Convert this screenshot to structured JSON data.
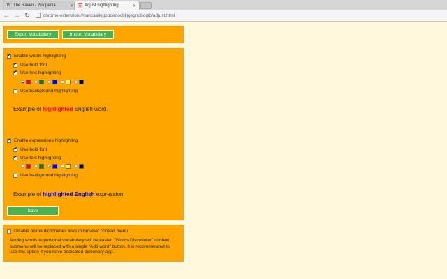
{
  "browser": {
    "tabs": [
      {
        "label": "The Raven - Wikipedia",
        "favicon": "W"
      },
      {
        "label": "Adjust highlighting",
        "favicon": "adjust"
      }
    ],
    "url": "chrome-extension://nancaalkjgpbdeoocblljgegnobogib/adjust.html"
  },
  "vocab": {
    "export_label": "Export Vocabulary",
    "import_label": "Import Vocabulary"
  },
  "words": {
    "enable_label": "Enable words highlighting",
    "bold_label": "Use bold font",
    "text_label": "Use text highlighting",
    "bg_label": "Use background highlighting",
    "colors": [
      "#ff0000",
      "#008000",
      "#0000ff",
      "#ffff00",
      "#000000"
    ],
    "selected_color_index": 0,
    "example_prefix": "Example of ",
    "example_highlight": "highlighted",
    "example_suffix": " English word.",
    "highlight_color": "#ff0000"
  },
  "expressions": {
    "enable_label": "Enable expressions highlighting",
    "bold_label": "Use bold font",
    "text_label": "Use text highlighting",
    "bg_label": "Use background highlighting",
    "colors": [
      "#ff0000",
      "#008000",
      "#0000ff",
      "#ffff00",
      "#000000"
    ],
    "selected_color_index": 2,
    "example_prefix": "Example of ",
    "example_highlight": "highlighted English",
    "example_suffix": " expression.",
    "highlight_color": "#0000ff"
  },
  "save_label": "Save",
  "dictionary": {
    "disable_label": "Disable online dictionaries links in browser context menu",
    "note": "Adding words to personal vocabulary will be easier. \"Words Discoverer\" context submenu will be replaced with a single \"Add word\" button. It is recommended to use this option if you have dedicated dictionary app."
  }
}
